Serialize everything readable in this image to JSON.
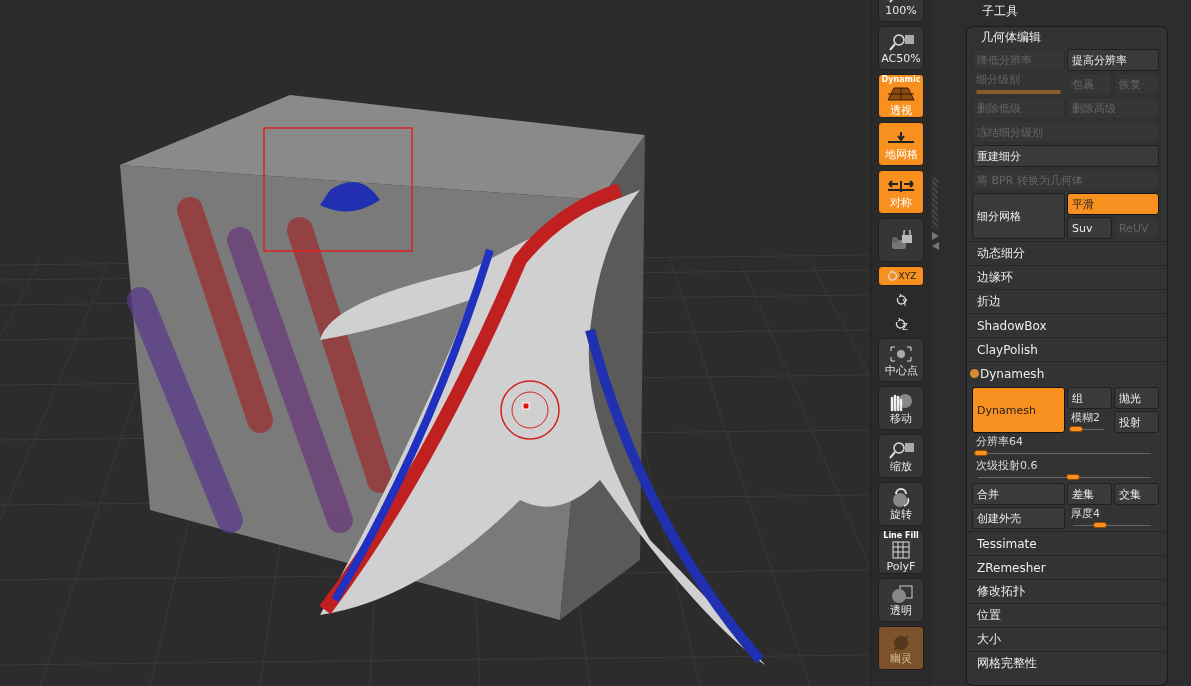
{
  "toolbar": [
    {
      "kind": "zoom",
      "label": "100%",
      "on": false,
      "disabled": false
    },
    {
      "kind": "zoom",
      "label": "AC50%",
      "on": false,
      "disabled": false
    },
    {
      "kind": "perspective",
      "top": "Dynamic",
      "label": "透视",
      "on": true,
      "disabled": false
    },
    {
      "kind": "floor",
      "label": "地网格",
      "on": true,
      "disabled": false
    },
    {
      "kind": "symmetry",
      "label": "对称",
      "on": true,
      "disabled": false
    },
    {
      "kind": "camera-lock",
      "on": false,
      "disabled": false
    },
    {
      "kind": "rotate-small",
      "label": "XYZ",
      "on": true,
      "disabled": false
    },
    {
      "kind": "rotate-plain",
      "label": "Y",
      "on": false,
      "disabled": false
    },
    {
      "kind": "rotate-plain",
      "label": "Z",
      "on": false,
      "disabled": false
    },
    {
      "kind": "center",
      "label": "中心点",
      "on": false,
      "disabled": false
    },
    {
      "kind": "move",
      "label": "移动",
      "on": false,
      "disabled": false
    },
    {
      "kind": "scale",
      "label": "缩放",
      "on": false,
      "disabled": false
    },
    {
      "kind": "rotate",
      "label": "旋转",
      "on": false,
      "disabled": false
    },
    {
      "kind": "polyframe",
      "top": "Line Fill",
      "label": "PolyF",
      "on": false,
      "disabled": false
    },
    {
      "kind": "transparent",
      "label": "透明",
      "on": false,
      "disabled": false
    },
    {
      "kind": "ghost",
      "label": "幽灵",
      "on": true,
      "disabled": true
    }
  ],
  "subtool_header": "子工具",
  "geometry": {
    "title": "几何体编辑",
    "controls": [
      {
        "kind": "button",
        "label": "降低分辨率",
        "on": false,
        "disabled": true
      },
      {
        "kind": "button",
        "label": "提高分辨率",
        "on": false,
        "disabled": false
      },
      {
        "kind": "slider",
        "label": "细分级别",
        "level": 1,
        "disabled": true
      },
      {
        "kind": "button",
        "label": "包裹",
        "on": false,
        "disabled": true
      },
      {
        "kind": "button",
        "label": "恢复",
        "on": false,
        "disabled": true
      },
      {
        "kind": "button",
        "label": "删除低级",
        "on": false,
        "disabled": true
      },
      {
        "kind": "button",
        "label": "删除高级",
        "on": false,
        "disabled": true
      },
      {
        "kind": "button",
        "label": "冻结细分级别",
        "on": false,
        "disabled": true
      },
      {
        "kind": "button",
        "label": "重建细分",
        "on": false,
        "disabled": false
      },
      {
        "kind": "button",
        "label": "将 BPR 转换为几何体",
        "on": false,
        "disabled": true
      },
      {
        "kind": "button",
        "label": "细分网格",
        "on": false,
        "disabled": false
      },
      {
        "kind": "button",
        "label": "平滑",
        "on": true,
        "disabled": false
      },
      {
        "kind": "button",
        "label": "Suv",
        "on": false,
        "disabled": false
      },
      {
        "kind": "button",
        "label": "ReUV",
        "on": false,
        "disabled": true
      }
    ]
  },
  "subpalettes": [
    {
      "title": "动态细分",
      "expanded": false
    },
    {
      "title": "边缘环",
      "expanded": false
    },
    {
      "title": "折边",
      "expanded": false
    },
    {
      "title": "ShadowBox",
      "expanded": false
    },
    {
      "title": "ClayPolish",
      "expanded": false
    },
    {
      "title": "Dynamesh",
      "expanded": true
    },
    {
      "title": "Tessimate",
      "expanded": false
    },
    {
      "title": "ZRemesher",
      "expanded": false
    },
    {
      "title": "修改拓扑",
      "expanded": false
    },
    {
      "title": "位置",
      "expanded": false
    },
    {
      "title": "大小",
      "expanded": false
    },
    {
      "title": "网格完整性",
      "expanded": false
    }
  ],
  "dynamesh": {
    "controls": [
      {
        "kind": "button",
        "label": "Dynamesh",
        "on": true,
        "disabled": false
      },
      {
        "kind": "button",
        "label": "组",
        "on": false,
        "disabled": false
      },
      {
        "kind": "button",
        "label": "抛光",
        "on": false,
        "disabled": false
      },
      {
        "kind": "slider",
        "label": "模糊",
        "value": "2",
        "level": 0.1,
        "disabled": false
      },
      {
        "kind": "button",
        "label": "投射",
        "on": false,
        "disabled": false
      },
      {
        "kind": "slider",
        "label": "分辨率",
        "value": "64",
        "level": 0.02,
        "disabled": false
      },
      {
        "kind": "slider",
        "label": "次级投射",
        "value": "0.6",
        "level": 0.55,
        "disabled": false
      },
      {
        "kind": "button",
        "label": "合并",
        "on": false,
        "disabled": false
      },
      {
        "kind": "button",
        "label": "差集",
        "on": false,
        "disabled": false
      },
      {
        "kind": "button",
        "label": "交集",
        "on": false,
        "disabled": false
      },
      {
        "kind": "button",
        "label": "创建外壳",
        "on": false,
        "disabled": false
      },
      {
        "kind": "slider",
        "label": "厚度",
        "value": "4",
        "level": 0.35,
        "disabled": false
      }
    ]
  }
}
